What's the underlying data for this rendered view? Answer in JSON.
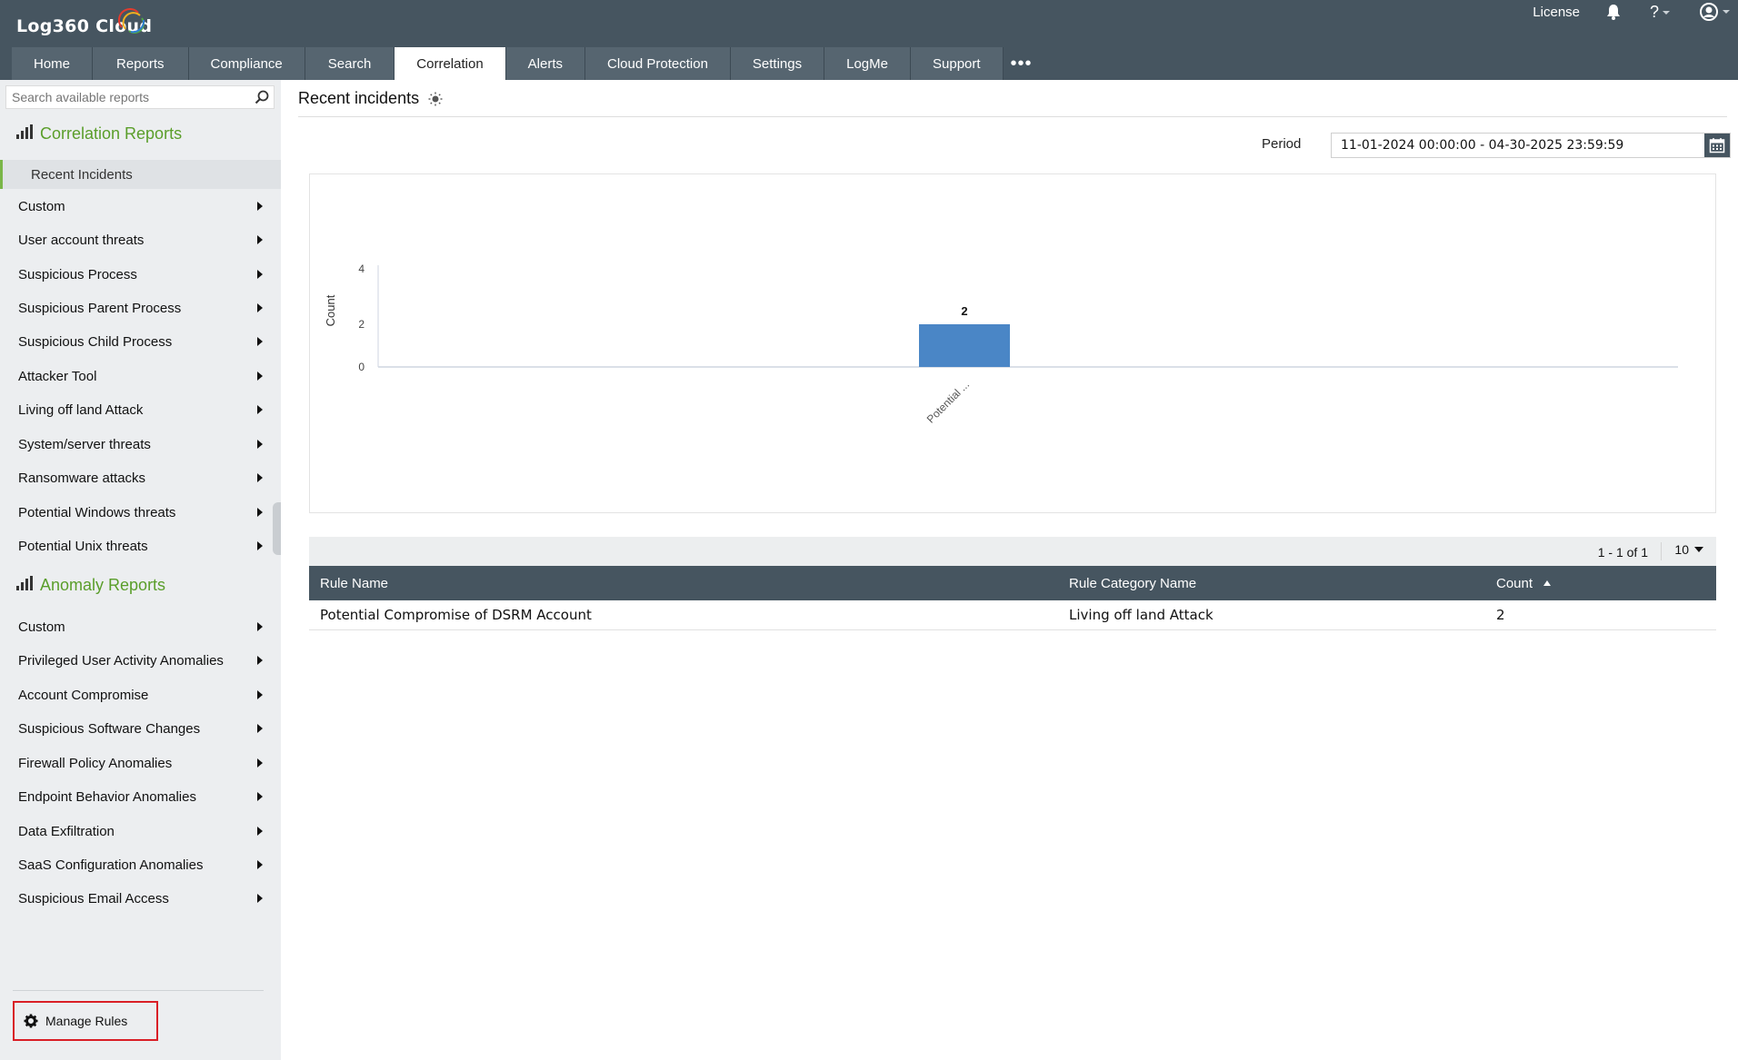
{
  "app": {
    "logo_text": "Log360  Cloud",
    "license_label": "License"
  },
  "tabs": [
    {
      "label": "Home"
    },
    {
      "label": "Reports"
    },
    {
      "label": "Compliance"
    },
    {
      "label": "Search"
    },
    {
      "label": "Correlation",
      "active": true
    },
    {
      "label": "Alerts"
    },
    {
      "label": "Cloud Protection"
    },
    {
      "label": "Settings"
    },
    {
      "label": "LogMe"
    },
    {
      "label": "Support"
    }
  ],
  "sidebar": {
    "search_placeholder": "Search available reports",
    "correlation_title": "Correlation Reports",
    "active_item": "Recent Incidents",
    "correlation_items": [
      {
        "label": "Custom"
      },
      {
        "label": "User account threats"
      },
      {
        "label": "Suspicious Process"
      },
      {
        "label": "Suspicious Parent Process"
      },
      {
        "label": "Suspicious Child Process"
      },
      {
        "label": "Attacker Tool"
      },
      {
        "label": "Living off land Attack"
      },
      {
        "label": "System/server threats"
      },
      {
        "label": "Ransomware attacks"
      },
      {
        "label": "Potential Windows threats"
      },
      {
        "label": "Potential Unix threats"
      }
    ],
    "anomaly_title": "Anomaly Reports",
    "anomaly_items": [
      {
        "label": "Custom"
      },
      {
        "label": "Privileged User Activity Anomalies"
      },
      {
        "label": "Account Compromise"
      },
      {
        "label": "Suspicious Software Changes"
      },
      {
        "label": "Firewall Policy Anomalies"
      },
      {
        "label": "Endpoint Behavior Anomalies"
      },
      {
        "label": "Data Exfiltration"
      },
      {
        "label": "SaaS Configuration Anomalies"
      },
      {
        "label": "Suspicious Email Access"
      }
    ],
    "manage_rules_label": "Manage Rules"
  },
  "main": {
    "page_title": "Recent incidents",
    "period_label": "Period",
    "period_value": "11-01-2024 00:00:00 - 04-30-2025 23:59:59",
    "pager_text": "1 - 1 of 1",
    "page_size": "10",
    "table": {
      "headers": [
        "Rule Name",
        "Rule Category Name",
        "Count"
      ],
      "rows": [
        [
          "Potential Compromise of DSRM Account",
          "Living off land Attack",
          "2"
        ]
      ]
    }
  },
  "colors": {
    "header_bg": "#465560",
    "accent_green": "#5a9e2a",
    "bar_blue": "#4a86c6",
    "highlight_red": "#d91f26"
  },
  "chart_data": {
    "type": "bar",
    "categories": [
      "Potential ..."
    ],
    "values": [
      2
    ],
    "data_labels": [
      "2"
    ],
    "ylabel": "Count",
    "ylim": [
      0,
      4
    ],
    "yticks": [
      0,
      2,
      4
    ]
  }
}
